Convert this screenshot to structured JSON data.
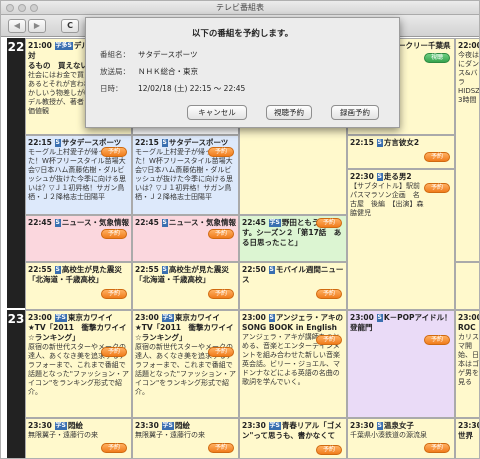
{
  "window": {
    "title": "テレビ番組表"
  },
  "toolbar": {
    "back": "◀",
    "forward": "▶",
    "reload": "C"
  },
  "hours": [
    "22",
    "23"
  ],
  "badges": {
    "s": "S",
    "word": "字S",
    "ms": "字多S"
  },
  "reserve": "予約",
  "view": "視聴",
  "dialog": {
    "title": "以下の番組を予約します。",
    "program_label": "番組名：",
    "program": "サタデースポーツ",
    "station_label": "放送局：",
    "station": "ＮＨＫ総合・東京",
    "datetime_label": "日時：",
    "datetime": "12/02/18 (土) 22:15 〜 22:45",
    "cancel": "キャンセル",
    "watch": "視聴予約",
    "record": "録画予約"
  },
  "cells": {
    "c1": {
      "time": "21:00",
      "title": "デル　究極の選対",
      "title2": "るもの　買えない",
      "desc": "社会にはお金で買えないものがあるとそれが言われてきた。しかしいう物差しが幅を利かせるデル教授が、著者とお金という価値観"
    },
    "c2": {
      "time": "22:15",
      "title": "サタデースポーツ",
      "desc": "モーグル上村愛子が帰ってきた！W杯フリースタイル苗場大会▽日本ハム斎藤佑樹・ダルビッシュが抜けた今季に向ける思いは？▽Ｊ１初昇格！サガン鳥栖・Ｊ２降格志士田陽平"
    },
    "c3": {
      "time": "22:15",
      "title": "サタデースポーツ",
      "desc": "モーグル上村愛子が帰ってきた！W杯フリースタイル苗場大会▽日本ハム斎藤佑樹・ダルビッシュが抜けた今季に向ける思いは？▽Ｊ１初昇格！サガン鳥栖・Ｊ２降格志士田陽平"
    },
    "c4": {
      "time": "22:45",
      "title": "ニュース・気象情報"
    },
    "c5": {
      "time": "22:45",
      "title": "ニュース・気象情報"
    },
    "c6": {
      "time": "22:45",
      "title": "野田ともうします。シーズン２「第17話　ある日思ったこと」"
    },
    "c7": {
      "time": "22:55",
      "title": "高校生が見た震災「北海道・千歳高校」"
    },
    "c8": {
      "time": "22:55",
      "title": "高校生が見た震災「北海道・千歳高校」"
    },
    "c9": {
      "time": "22:50",
      "title": "モバイル週間ニュース"
    },
    "c10": {
      "time": "",
      "title": "ークリー千葉県"
    },
    "c11": {
      "time": "22:00",
      "desc": "今夜はにダンス&バラHIDSZ！3時間"
    },
    "c12": {
      "time": "22:15",
      "title": "方言彼女2"
    },
    "c13": {
      "time": "22:30",
      "title": "走る男2",
      "desc": "【サブタイトル】駅前　パスマラソン企画　名古屋　後編　【出演】森脇健児"
    },
    "c14": {
      "time": "23:00",
      "title": "東京カワイイ★TV「2011　衝撃カワイイ☆ランキング」",
      "desc": "原宿の新世代スターやメークの達人、あくなき美を追求するアラフォーまで、これまで番組で話題となった\"ファッション・アイコン\"をランキング形式で紹介。"
    },
    "c15": {
      "time": "23:00",
      "title": "東京カワイイ★TV「2011　衝撃カワイイ☆ランキング」",
      "desc": "原宿の新世代スターやメークの達人、あくなき美を追求するアラフォーまで、これまで番組で話題となった\"ファッション・アイコン\"をランキング形式で紹介。"
    },
    "c16": {
      "time": "23:00",
      "title": "アンジェラ・アキのSONG BOOK in English",
      "desc": "アンジェラ・アキが講師をつとめる、音楽とエンターテインメントを組み合わせた新しい音楽英会話。ビリー・ジョエル、マドンナなどによる英語の名曲の歌詞を学んでいく。"
    },
    "c17": {
      "time": "23:00",
      "title": "K－POPアイドル！登龍門"
    },
    "c18": {
      "time": "23:00",
      "title": "ROC",
      "desc": "カリスマ開始、日本はゴゲ男を見る"
    },
    "c19": {
      "time": "23:30",
      "title": "悶絵",
      "desc": "無限翼子・遠藤行の来"
    },
    "c20": {
      "time": "23:30",
      "title": "悶絵",
      "desc": "無限翼子・遠藤行の来"
    },
    "c21": {
      "time": "23:30",
      "title": "青春リアル「ゴメン\"って思うも、書かなくて"
    },
    "c22": {
      "time": "23:30",
      "title": "温泉女子",
      "desc": "千葉県小湊鉄道の源流泉"
    },
    "c23": {
      "time": "23:30",
      "title": "世界"
    }
  }
}
